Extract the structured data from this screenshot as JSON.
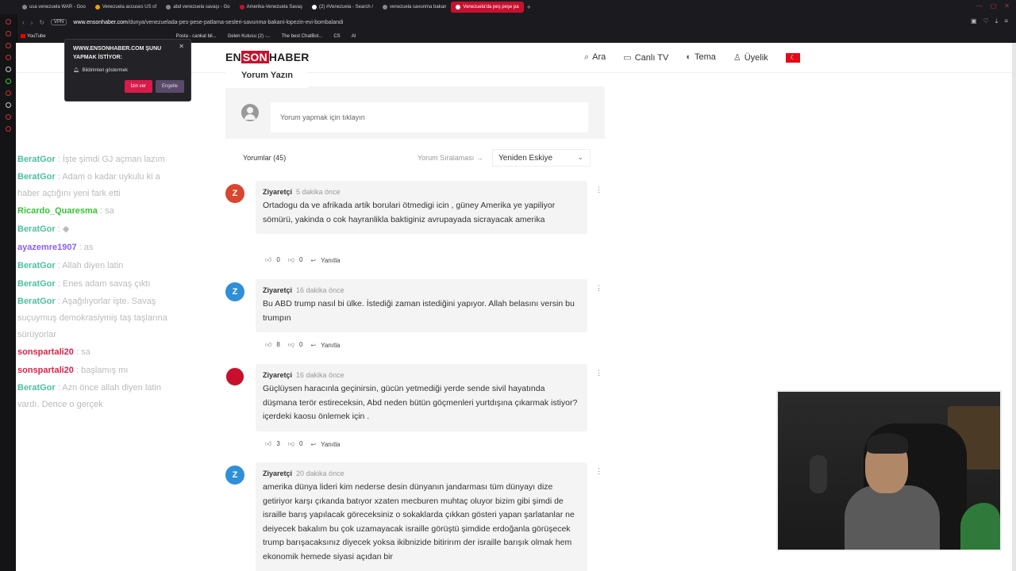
{
  "tabs": [
    {
      "label": "usa venezuela WAR - Goo"
    },
    {
      "label": "Venezuela accuses US of"
    },
    {
      "label": "abd venezuela savaşı - Go"
    },
    {
      "label": "Amerika-Venezuela Savaş"
    },
    {
      "label": "(2) #Venezuela - Search /"
    },
    {
      "label": "venezuela savunma bakan"
    },
    {
      "label": "Venezuela'da peş peşe pa"
    }
  ],
  "address": {
    "vpn": "VPN",
    "domain": "www.ensonhaber.com",
    "path": "/dunya/venezuelada-pes-pese-patlama-sesleri-savunma-bakani-lopezin-evi-bombalandi"
  },
  "bookmarks": [
    "YouTube",
    "Posta - cankat bil...",
    "Gelen Kutusu (2) -...",
    "The best ChatBot...",
    "CS",
    "AI"
  ],
  "notification": {
    "title": "WWW.ENSONHABER.COM ŞUNU YAPMAK İSTİYOR:",
    "line": "Bildirimleri göstermek",
    "allow": "İzin ver",
    "block": "Engelle"
  },
  "site": {
    "logo_a": "EN",
    "logo_b": "SON",
    "logo_c": "HABER",
    "menu": {
      "search": "Ara",
      "live": "Canlı TV",
      "theme": "Tema",
      "member": "Üyelik"
    }
  },
  "comments_section": {
    "write_title": "Yorum Yazın",
    "input_placeholder": "Yorum yapmak için tıklayın",
    "count_label": "Yorumlar (45)",
    "sort_label": "Yorum Sıralaması →",
    "sort_value": "Yeniden Eskiye",
    "reply_label": "Yanıtla"
  },
  "comments": [
    {
      "avatar": "Z",
      "author": "Ziyaretçi",
      "time": "5 dakika önce",
      "text": "Ortadogu da ve afrikada artik borulari ötmedigi icin , güney Amerika ye yapiliyor sömürü, yakinda o cok hayranlikla baktiginiz avrupayada sicrayacak amerika",
      "likes": "0",
      "dislikes": "0"
    },
    {
      "avatar": "Z",
      "author": "Ziyaretçi",
      "time": "16 dakika önce",
      "text": "Bu ABD trump nasıl bi ülke. İstediği zaman istediğini yapıyor. Allah belasını versin bu trumpın",
      "likes": "8",
      "dislikes": "0"
    },
    {
      "avatar": "",
      "author": "Ziyaretçi",
      "time": "16 dakika önce",
      "text": "Güçlüysen haracınla geçinirsin, gücün yetmediği yerde sende sivil hayatında düşmana terör estireceksin, Abd neden bütün göçmenleri yurtdışına çıkarmak istiyor? içerdeki kaosu önlemek için .",
      "likes": "3",
      "dislikes": "0"
    },
    {
      "avatar": "Z",
      "author": "Ziyaretçi",
      "time": "20 dakika önce",
      "text": "amerika dünya lideri kim nederse desin dünyanın jandarması tüm dünyayı dize getiriyor karşı çıkanda batıyor xzaten mecburen muhtaç oluyor bizim gibi şimdi de israille barış yapılacak göreceksiniz o sokaklarda çıkkan gösteri yapan şarlatanlar ne deiyecek bakalım bu çok uzamayacak israille görüştü şimdide erdoğanla görüşecek trump barışacaksınız diyecek yoksa ikibnizide bitirirım der israille barışık olmak hem ekonomik hemede siyasi açıdan bir",
      "likes": "",
      "dislikes": ""
    }
  ],
  "chat": [
    {
      "user": "BeratGor",
      "msg": ": İşte şimdi GJ açman lazım"
    },
    {
      "user": "BeratGor",
      "msg": ": Adam o kadar uykulu ki a haber açtığını yeni fark etti"
    },
    {
      "user": "Ricardo_Quaresma",
      "msg": ": sa"
    },
    {
      "user": "BeratGor",
      "msg": ":"
    },
    {
      "user": "ayazemre1907",
      "msg": ": as"
    },
    {
      "user": "BeratGor",
      "msg": ": Allah diyen latin"
    },
    {
      "user": "BeratGor",
      "msg": ": Enes adam savaş çıktı"
    },
    {
      "user": "BeratGor",
      "msg": ": Aşağılıyorlar işte. Savaş suçuymuş demokrasiymiş taş taşlarına sürüyorlar"
    },
    {
      "user": "sonspartali20",
      "msg": ": sa"
    },
    {
      "user": "sonspartali20",
      "msg": ": başlamış mı"
    },
    {
      "user": "BeratGor",
      "msg": ": Azn önce allah diyen latin vardı. Dence o gerçek"
    }
  ],
  "colors": {
    "brand": "#c8102e",
    "avatar_blue": "#2f8fd8",
    "avatar_red": "#d9452f"
  }
}
